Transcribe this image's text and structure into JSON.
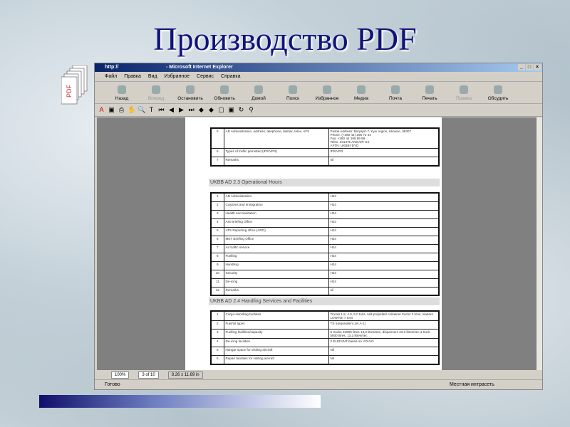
{
  "slide_title": "Производство PDF",
  "pdf_icon_label": "PDF",
  "window": {
    "url": "http://",
    "title": "- Microsoft Internet Explorer"
  },
  "menu": [
    "Файл",
    "Правка",
    "Вид",
    "Избранное",
    "Сервис",
    "Справка"
  ],
  "toolbar": [
    "Назад",
    "Вперед",
    "Остановить",
    "Обновить",
    "Домой",
    "Поиск",
    "Избранное",
    "Медиа",
    "Почта",
    "Печать",
    "Правка",
    "Обсудить"
  ],
  "doc": {
    "t1": [
      [
        "5",
        "AD Administration, address, telephone, telefax, telex, AFS",
        "Postal Address: Boryspil'-7, Kyiv region, Ukraine, 08307\nPhone: (+380 44) 296 72 44\nFax: +380 44 295 89 99\nTelex: 331475 ANGAIR UX\nAFTN: UKBBYDYD"
      ],
      [
        "6",
        "Types of traffic permitted (IFR/VFR)",
        "IFR/VFR"
      ],
      [
        "7",
        "Remarks",
        "nil"
      ]
    ],
    "h2": "UKBB AD 2.3 Operational Hours",
    "t2": [
      [
        "1",
        "AD Administration",
        "H24"
      ],
      [
        "2",
        "Customs and immigration",
        "H24"
      ],
      [
        "3",
        "Health and sanitation",
        "H24"
      ],
      [
        "4",
        "AIS Briefing Office",
        "H24"
      ],
      [
        "5",
        "ATS Reporting office (ARO)",
        "H24"
      ],
      [
        "6",
        "MET Briefing Office",
        "H24"
      ],
      [
        "7",
        "Air traffic service",
        "H24"
      ],
      [
        "8",
        "Fuelling",
        "H24"
      ],
      [
        "9",
        "Handling",
        "H24"
      ],
      [
        "10",
        "Security",
        "H24"
      ],
      [
        "11",
        "De-icing",
        "H24"
      ],
      [
        "12",
        "Remarks",
        "nil"
      ]
    ],
    "h3": "UKBB AD 2.4 Handling Services and Facilities",
    "t3": [
      [
        "1",
        "Cargo-Handling facilities",
        "Trucks 1,5, 4.0, 5.0 tons, self-propelled container trucks 3 tons, loaders LOW70II 7 tons"
      ],
      [
        "2",
        "Fuel/oil types",
        "TS-1(equivalent Jet A-1)"
      ],
      [
        "3",
        "Fuelling facilities/capacity",
        "6 trucks 22080 litres 13,3 litres/sec, dispensers 23.3 litres/sec,1 truck 5800 litres, 13.3 litres/sec"
      ],
      [
        "4",
        "De-icing facilities",
        "2 ELEFANT based on VOLVO"
      ],
      [
        "5",
        "Hangar space for visiting aircraft",
        "Nil"
      ],
      [
        "6",
        "Repair facilities for visiting aircraft",
        "Nil"
      ]
    ]
  },
  "nav": {
    "zoom": "100%",
    "page": "3 of 10",
    "size": "8.26 x 11.69 in"
  },
  "status": {
    "text": "Готово",
    "zone": "Местная интрасеть"
  }
}
